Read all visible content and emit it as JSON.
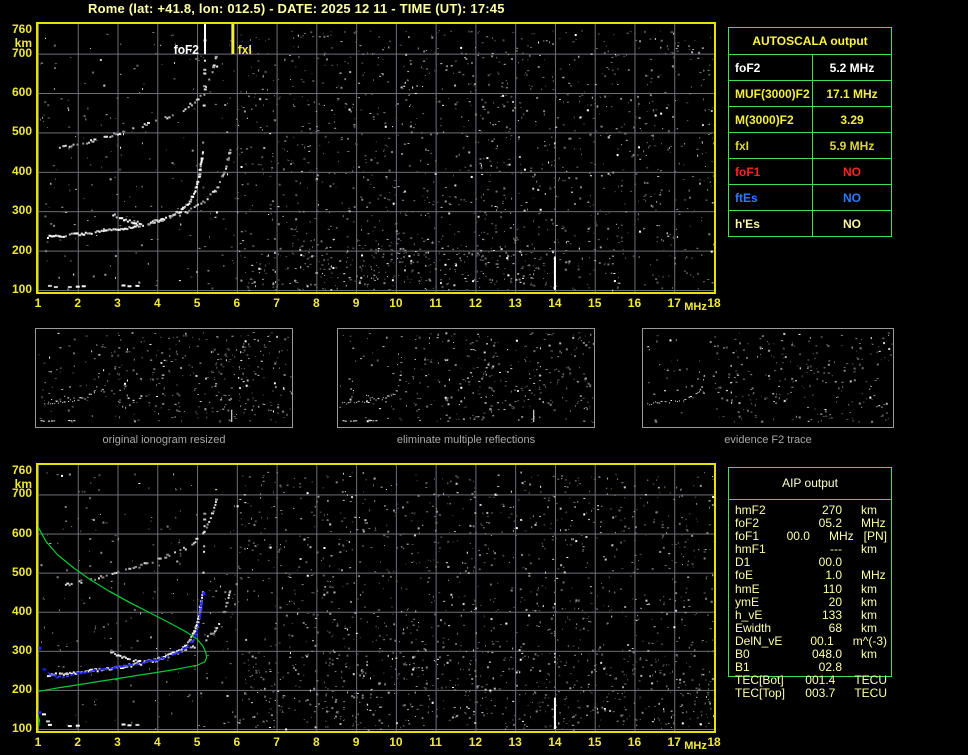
{
  "header": {
    "title": "Rome (lat: +41.8, lon: 012.5) - DATE: 2025 12 11 - TIME (UT): 17:45"
  },
  "colors": {
    "background": "#000000",
    "title_text": "#ffffa6",
    "axis_yellow": "#f0e83a",
    "plot_border": "#e8e000",
    "grid": "#6f6f78",
    "table_border_green": "#3fe05a",
    "autoscala_header": "#fdf53e",
    "aip_text": "#ffffa8",
    "trace_white": "#ffffff",
    "restored_trace_blue": "#2222ee",
    "profile_green": "#00cc33",
    "red": "#ff2222",
    "blue": "#2b7bff"
  },
  "autoscala": {
    "header": "AUTOSCALA output",
    "rows": [
      {
        "label": "foF2",
        "value": "5.2 MHz",
        "color": "#ffffff"
      },
      {
        "label": "MUF(3000)F2",
        "value": "17.1 MHz",
        "color": "#f3ed3e"
      },
      {
        "label": "M(3000)F2",
        "value": "3.29",
        "color": "#f3ed3e"
      },
      {
        "label": "fxI",
        "value": "5.9 MHz",
        "color": "#dcd53a"
      },
      {
        "label": "foF1",
        "value": "NO",
        "color": "#ff2222"
      },
      {
        "label": "ftEs",
        "value": "NO",
        "color": "#2b7bff"
      },
      {
        "label": "h'Es",
        "value": "NO",
        "color": "#fbf6a0"
      }
    ]
  },
  "aip": {
    "header": "AIP output",
    "rows": [
      {
        "label": "hmF2",
        "value": "270",
        "unit": "km"
      },
      {
        "label": "foF2",
        "value": "05.2",
        "unit": "MHz"
      },
      {
        "label": "foF1",
        "value": "00.0",
        "unit": "MHz   [PN]"
      },
      {
        "label": "hmF1",
        "value": "---",
        "unit": "km"
      },
      {
        "label": "D1",
        "value": "00.0",
        "unit": ""
      },
      {
        "label": "foE",
        "value": "1.0",
        "unit": "MHz"
      },
      {
        "label": "hmE",
        "value": "110",
        "unit": "km"
      },
      {
        "label": "ymE",
        "value": "20",
        "unit": "km"
      },
      {
        "label": "h_vE",
        "value": "133",
        "unit": "km"
      },
      {
        "label": "Ewidth",
        "value": "68",
        "unit": "km"
      },
      {
        "label": "DelN_vE",
        "value": "00.1",
        "unit": "m^(-3)"
      },
      {
        "label": "B0",
        "value": "048.0",
        "unit": "km"
      },
      {
        "label": "B1",
        "value": "02.8",
        "unit": ""
      },
      {
        "label": "TEC[Bot]",
        "value": "001.4",
        "unit": "TECU"
      },
      {
        "label": "TEC[Top]",
        "value": "003.7",
        "unit": "TECU"
      }
    ]
  },
  "thumbnails": [
    {
      "caption": "original ionogram resized",
      "series": [
        "second_hop",
        "o_trace",
        "o_asymptote",
        "x_trace",
        "branch",
        "e_marks"
      ],
      "vline14": true,
      "noise_scale": 1.0
    },
    {
      "caption": "eliminate multiple reflections",
      "series": [
        "o_trace",
        "o_asymptote",
        "x_trace",
        "branch",
        "e_marks"
      ],
      "vline14": true,
      "noise_scale": 1.0
    },
    {
      "caption": "evidence F2 trace",
      "series": [
        "o_trace",
        "x_trace"
      ],
      "vline14": false,
      "noise_scale": 0.8
    }
  ],
  "chart_data": [
    {
      "id": "top-ionogram",
      "type": "scatter",
      "xlabel": "MHz",
      "ylabel": "km",
      "xlim": [
        1,
        18
      ],
      "ylim": [
        100,
        760
      ],
      "xticks": [
        1,
        2,
        3,
        4,
        5,
        6,
        7,
        8,
        9,
        10,
        11,
        12,
        13,
        14,
        15,
        16,
        17,
        18
      ],
      "yticks": [
        760,
        700,
        600,
        500,
        400,
        300,
        200,
        100
      ],
      "grid": true,
      "markers": [
        {
          "name": "foF2",
          "label": "foF2",
          "x": 5.2,
          "value_mhz": 5.2,
          "color": "#ffffff",
          "label_side": "left"
        },
        {
          "name": "fxI",
          "label": "fxI",
          "x": 5.9,
          "value_mhz": 5.9,
          "color": "#f3ed3e",
          "label_side": "right"
        }
      ],
      "series": [
        {
          "name": "o_trace",
          "style": "bright",
          "points": [
            [
              1.25,
              237
            ],
            [
              1.6,
              240
            ],
            [
              2.0,
              244
            ],
            [
              2.4,
              248
            ],
            [
              2.8,
              253
            ],
            [
              3.2,
              259
            ],
            [
              3.6,
              267
            ],
            [
              4.0,
              277
            ],
            [
              4.3,
              288
            ],
            [
              4.6,
              303
            ],
            [
              4.8,
              322
            ],
            [
              4.95,
              350
            ],
            [
              5.05,
              385
            ],
            [
              5.1,
              420
            ],
            [
              5.15,
              455
            ]
          ]
        },
        {
          "name": "o_asymptote",
          "style": "sparse",
          "points": [
            [
              5.15,
              470
            ],
            [
              5.17,
              520
            ],
            [
              5.18,
              575
            ],
            [
              5.19,
              630
            ],
            [
              5.2,
              690
            ],
            [
              5.2,
              740
            ]
          ]
        },
        {
          "name": "x_trace",
          "style": "gray",
          "points": [
            [
              3.7,
              270
            ],
            [
              4.1,
              280
            ],
            [
              4.5,
              292
            ],
            [
              4.9,
              308
            ],
            [
              5.2,
              328
            ],
            [
              5.45,
              352
            ],
            [
              5.6,
              378
            ],
            [
              5.72,
              408
            ],
            [
              5.8,
              440
            ],
            [
              5.85,
              460
            ]
          ]
        },
        {
          "name": "branch",
          "style": "bright",
          "points": [
            [
              2.85,
              297
            ],
            [
              3.0,
              288
            ],
            [
              3.2,
              280
            ],
            [
              3.4,
              275
            ],
            [
              3.6,
              272
            ]
          ]
        },
        {
          "name": "second_hop",
          "style": "gray",
          "points": [
            [
              1.55,
              462
            ],
            [
              1.9,
              470
            ],
            [
              2.3,
              480
            ],
            [
              2.7,
              490
            ],
            [
              3.1,
              502
            ],
            [
              3.5,
              515
            ],
            [
              3.9,
              528
            ],
            [
              4.3,
              543
            ],
            [
              4.7,
              562
            ],
            [
              5.0,
              584
            ],
            [
              5.2,
              610
            ],
            [
              5.35,
              645
            ],
            [
              5.45,
              680
            ],
            [
              5.5,
              700
            ]
          ]
        },
        {
          "name": "e_marks",
          "style": "dashes",
          "points": [
            [
              1.3,
              113
            ],
            [
              1.45,
              110
            ],
            [
              1.8,
              110
            ],
            [
              2.0,
              111
            ],
            [
              2.15,
              112
            ],
            [
              3.15,
              114
            ],
            [
              3.3,
              112
            ],
            [
              3.5,
              113
            ]
          ]
        },
        {
          "name": "interference_line",
          "style": "vline",
          "x": 14,
          "y_from": 100,
          "y_to": 185
        }
      ],
      "noise": [
        {
          "x": [
            1,
            5.9
          ],
          "y": [
            100,
            760
          ],
          "count": 210
        },
        {
          "x": [
            5.9,
            18
          ],
          "y": [
            100,
            760
          ],
          "count": 1500
        },
        {
          "x": [
            6,
            14
          ],
          "y": [
            100,
            215
          ],
          "count": 260
        }
      ]
    },
    {
      "id": "bottom-ionogram",
      "type": "scatter",
      "xlabel": "MHz",
      "ylabel": "km",
      "xlim": [
        1,
        18
      ],
      "ylim": [
        100,
        760
      ],
      "xticks": [
        1,
        2,
        3,
        4,
        5,
        6,
        7,
        8,
        9,
        10,
        11,
        12,
        13,
        14,
        15,
        16,
        17,
        18
      ],
      "yticks": [
        760,
        700,
        600,
        500,
        400,
        300,
        200,
        100
      ],
      "grid": true,
      "markers": [],
      "series": [
        {
          "name": "o_trace",
          "style": "bright",
          "points": [
            [
              1.25,
              240
            ],
            [
              1.6,
              243
            ],
            [
              2.0,
              247
            ],
            [
              2.4,
              252
            ],
            [
              2.8,
              257
            ],
            [
              3.2,
              263
            ],
            [
              3.6,
              270
            ],
            [
              4.0,
              280
            ],
            [
              4.3,
              291
            ],
            [
              4.6,
              306
            ],
            [
              4.8,
              325
            ],
            [
              4.95,
              352
            ],
            [
              5.05,
              387
            ],
            [
              5.1,
              422
            ],
            [
              5.15,
              455
            ]
          ]
        },
        {
          "name": "o_asymptote",
          "style": "sparse",
          "points": [
            [
              5.15,
              470
            ],
            [
              5.17,
              520
            ],
            [
              5.18,
              575
            ],
            [
              5.19,
              630
            ],
            [
              5.2,
              690
            ]
          ]
        },
        {
          "name": "x_trace",
          "style": "gray",
          "points": [
            [
              3.7,
              273
            ],
            [
              4.1,
              283
            ],
            [
              4.5,
              295
            ],
            [
              4.9,
              311
            ],
            [
              5.2,
              330
            ],
            [
              5.45,
              354
            ],
            [
              5.6,
              380
            ],
            [
              5.72,
              410
            ],
            [
              5.8,
              442
            ],
            [
              5.85,
              460
            ]
          ]
        },
        {
          "name": "branch",
          "style": "bright",
          "points": [
            [
              2.85,
              300
            ],
            [
              3.0,
              291
            ],
            [
              3.2,
              283
            ],
            [
              3.4,
              278
            ],
            [
              3.6,
              275
            ]
          ]
        },
        {
          "name": "second_hop",
          "style": "gray",
          "points": [
            [
              1.7,
              470
            ],
            [
              2.0,
              477
            ],
            [
              2.4,
              486
            ],
            [
              2.8,
              496
            ],
            [
              3.2,
              508
            ],
            [
              3.6,
              520
            ],
            [
              4.0,
              534
            ],
            [
              4.4,
              550
            ],
            [
              4.8,
              570
            ],
            [
              5.05,
              592
            ],
            [
              5.25,
              620
            ],
            [
              5.4,
              655
            ],
            [
              5.5,
              690
            ]
          ]
        },
        {
          "name": "e_marks",
          "style": "dashes",
          "points": [
            [
              1.15,
              140
            ],
            [
              1.25,
              122
            ],
            [
              1.3,
              113
            ],
            [
              1.8,
              110
            ],
            [
              2.0,
              111
            ],
            [
              3.15,
              114
            ],
            [
              3.3,
              112
            ],
            [
              3.5,
              113
            ]
          ]
        },
        {
          "name": "interference_line",
          "style": "vline",
          "x": 14,
          "y_from": 100,
          "y_to": 180
        },
        {
          "name": "restored_trace",
          "style": "blue",
          "points": [
            [
              1.15,
              256
            ],
            [
              1.3,
              243
            ],
            [
              1.5,
              235
            ],
            [
              1.7,
              237
            ],
            [
              2.0,
              245
            ],
            [
              2.4,
              252
            ],
            [
              2.8,
              258
            ],
            [
              3.2,
              264
            ],
            [
              3.6,
              271
            ],
            [
              4.0,
              280
            ],
            [
              4.4,
              293
            ],
            [
              4.7,
              308
            ],
            [
              4.9,
              327
            ],
            [
              5.0,
              350
            ],
            [
              5.07,
              385
            ],
            [
              5.1,
              415
            ],
            [
              5.13,
              440
            ]
          ]
        },
        {
          "name": "restored_isolated",
          "style": "blue_pts",
          "points": [
            [
              1.03,
              308
            ],
            [
              1.03,
              143
            ],
            [
              5.16,
              448
            ]
          ]
        },
        {
          "name": "density_profile",
          "style": "green",
          "points": [
            [
              1.0,
              617
            ],
            [
              1.2,
              580
            ],
            [
              1.5,
              545
            ],
            [
              1.9,
              512
            ],
            [
              2.3,
              483
            ],
            [
              2.8,
              452
            ],
            [
              3.3,
              424
            ],
            [
              3.8,
              398
            ],
            [
              4.3,
              372
            ],
            [
              4.7,
              350
            ],
            [
              5.0,
              330
            ],
            [
              5.15,
              312
            ],
            [
              5.22,
              295
            ],
            [
              5.24,
              283
            ],
            [
              5.2,
              272
            ],
            [
              5.0,
              263
            ],
            [
              4.5,
              253
            ],
            [
              4.0,
              245
            ],
            [
              3.5,
              237
            ],
            [
              3.0,
              229
            ],
            [
              2.5,
              221
            ],
            [
              2.0,
              213
            ],
            [
              1.5,
              205
            ],
            [
              1.0,
              196
            ]
          ]
        },
        {
          "name": "density_profile_E",
          "style": "green",
          "points": [
            [
              1.0,
              135
            ],
            [
              1.04,
              121
            ],
            [
              1.0,
              106
            ]
          ]
        }
      ],
      "noise": [
        {
          "x": [
            1,
            5.9
          ],
          "y": [
            100,
            760
          ],
          "count": 210
        },
        {
          "x": [
            5.9,
            18
          ],
          "y": [
            100,
            760
          ],
          "count": 1500
        },
        {
          "x": [
            6,
            18
          ],
          "y": [
            100,
            300
          ],
          "count": 300
        }
      ]
    }
  ]
}
